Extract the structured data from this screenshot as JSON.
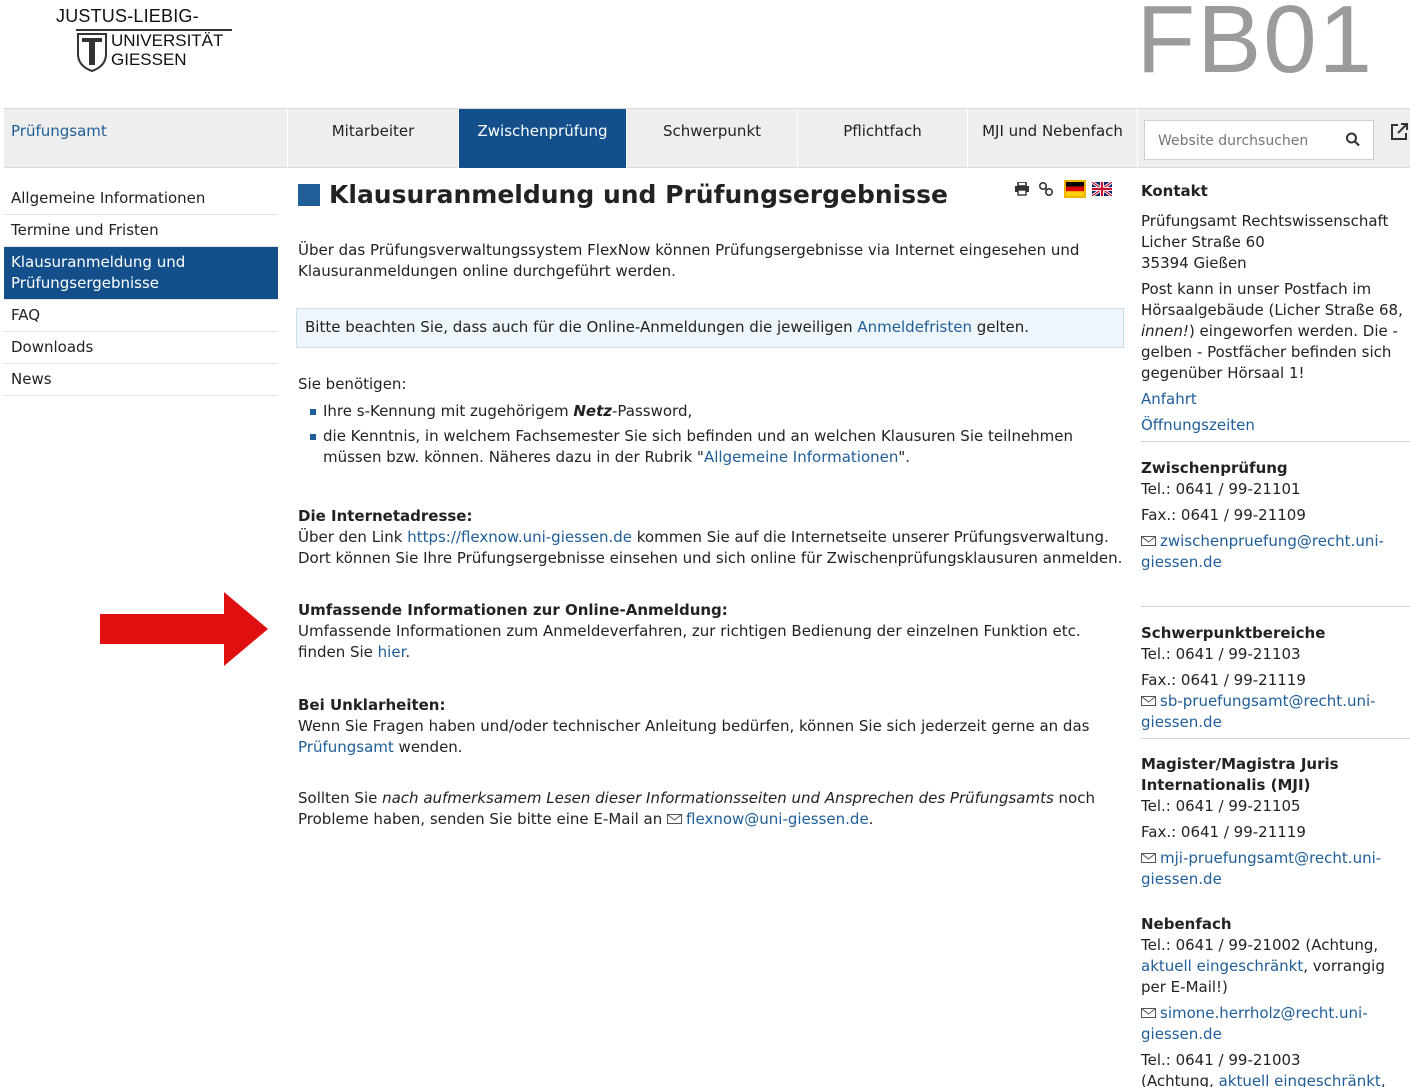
{
  "header": {
    "logo": {
      "line1": "JUSTUS-LIEBIG-",
      "line2": "UNIVERSITÄT",
      "line3": "GIESSEN"
    },
    "faculty_mark": "FB01"
  },
  "nav": {
    "items": [
      {
        "label": "Prüfungsamt"
      },
      {
        "label": "Mitarbeiter"
      },
      {
        "label": "Zwischenprüfung"
      },
      {
        "label": "Schwerpunkt"
      },
      {
        "label": "Pflichtfach"
      },
      {
        "label": "MJI und Nebenfach"
      }
    ],
    "active_index": 2,
    "search_placeholder": "Website durchsuchen",
    "search_icon": "search-icon",
    "external_icon": "external-link-icon"
  },
  "sidebar": {
    "items": [
      {
        "label": "Allgemeine Informationen"
      },
      {
        "label": "Termine und Fristen"
      },
      {
        "label": "Klausuranmeldung und Prüfungsergebnisse"
      },
      {
        "label": "FAQ"
      },
      {
        "label": "Downloads"
      },
      {
        "label": "News"
      }
    ]
  },
  "main": {
    "title": "Klausuranmeldung und Prüfungsergebnisse",
    "tool_icons": [
      "print-icon",
      "link-icon",
      "flag-de-icon",
      "flag-uk-icon"
    ],
    "intro": "Über das Prüfungsverwaltungssystem FlexNow können Prüfungsergebnisse via Internet eingesehen und Klausuranmeldungen online durchgeführt werden.",
    "notice": {
      "before": "Bitte beachten Sie, dass auch für die Online-Anmeldungen die jeweiligen ",
      "link": "Anmeldefristen",
      "after": " gelten."
    },
    "need_heading": "Sie benötigen:",
    "bullet1": {
      "before": "Ihre s-Kennung mit zugehörigem ",
      "emph": "Netz",
      "after": "-Password,"
    },
    "bullet2": {
      "before": "die Kenntnis, in welchem Fachsemester Sie sich befinden und an welchen Klausuren Sie teilnehmen müssen bzw. können. Näheres dazu in der Rubrik \"",
      "link": "Allgemeine Informationen",
      "after": "\"."
    },
    "internet": {
      "heading": "Die Internetadresse:",
      "before": "Über den Link ",
      "link": "https://flexnow.uni-giessen.de",
      "after": " kommen Sie auf die Internetseite unserer Prüfungsverwaltung. Dort können Sie Ihre Prüfungsergebnisse einsehen und sich online für Zwischenprüfungsklausuren anmelden."
    },
    "online": {
      "heading": "Umfassende Informationen zur Online-Anmeldung:",
      "before": "Umfassende Informationen zum Anmeldeverfahren, zur richtigen Bedienung der einzelnen Funktion etc. finden Sie ",
      "link": "hier",
      "after": "."
    },
    "unclear": {
      "heading": "Bei Unklarheiten:",
      "before": "Wenn Sie Fragen haben und/oder technischer Anleitung bedürfen, können Sie sich jederzeit gerne an das ",
      "link": "Prüfungsamt",
      "after": " wenden."
    },
    "closing": {
      "before": "Sollten Sie ",
      "emph": "nach aufmerksamem Lesen dieser Informationsseiten und Ansprechen des Prüfungsamts",
      "middle": " noch Probleme haben, senden Sie bitte eine E-Mail an ",
      "link": "flexnow@uni-giessen.de",
      "after": "."
    }
  },
  "contact": {
    "heading": "Kontakt",
    "address": [
      "Prüfungsamt Rechtswissenschaft",
      "Licher Straße 60",
      "35394 Gießen"
    ],
    "post": {
      "before": "Post kann in unser Postfach im Hörsaalgebäude (Licher Straße 68, ",
      "emph": "innen!",
      "after": ") eingeworfen werden. Die - gelben - Postfächer befinden sich gegenüber Hörsaal 1!"
    },
    "link_anfahrt": "Anfahrt",
    "link_hours": "Öffnungszeiten",
    "zwischen": {
      "heading": "Zwischenprüfung",
      "tel": "Tel.:  0641 / 99-21101",
      "fax": "Fax.: 0641 / 99-21109",
      "mail": "zwischenpruefung@recht.uni-giessen.de"
    },
    "schwer": {
      "heading": "Schwerpunktbereiche",
      "tel": "Tel.:  0641 / 99-21103",
      "fax": "Fax.: 0641 / 99-21119",
      "mail": "sb-pruefungsamt@recht.uni-giessen.de"
    },
    "mji": {
      "heading": "Magister/Magistra Juris Internationalis (MJI)",
      "tel": "Tel.:  0641 / 99-21105",
      "fax": "Fax.: 0641 / 99-21119",
      "mail": "mji-pruefungsamt@recht.uni-giessen.de"
    },
    "neben": {
      "heading": "Nebenfach",
      "tel1_before": "Tel.: 0641 / 99-21002 (Achtung, ",
      "tel1_link": "aktuell eingeschränkt",
      "tel1_after": ", vorrangig per E-Mail!)",
      "mail": "simone.herrholz@recht.uni-giessen.de",
      "tel2": "Tel.: 0641 / 99-21003",
      "tel2_note_before": "(Achtung, ",
      "tel2_note_link": "aktuell eingeschränkt",
      "tel2_note_after": ","
    }
  }
}
